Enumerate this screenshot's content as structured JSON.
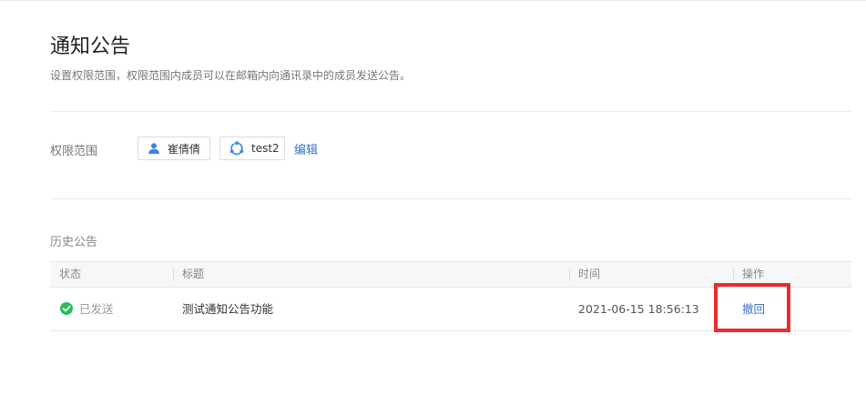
{
  "page": {
    "title": "通知公告",
    "description": "设置权限范围，权限范围内成员可以在邮箱内向通讯录中的成员发送公告。"
  },
  "permission": {
    "label": "权限范围",
    "members": [
      {
        "name": "崔倩倩",
        "icon": "user-icon"
      },
      {
        "name": "test2",
        "icon": "department-icon"
      }
    ],
    "edit_label": "编辑"
  },
  "history": {
    "section_title": "历史公告",
    "columns": [
      "状态",
      "标题",
      "时间",
      "操作"
    ],
    "rows": [
      {
        "status": "已发送",
        "status_icon": "check-circle-icon",
        "title": "测试通知公告功能",
        "time": "2021-06-15 18:56:13",
        "action": "撤回"
      }
    ]
  },
  "colors": {
    "link": "#3a73c8",
    "success": "#2dbb5d",
    "highlight": "#ec2b2b"
  }
}
